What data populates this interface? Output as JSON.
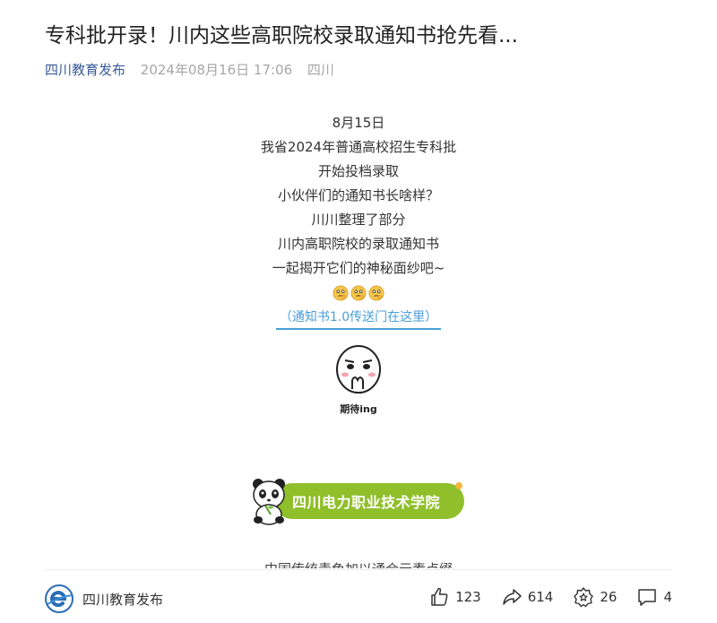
{
  "article": {
    "title": "专科批开录！川内这些高职院校录取通知书抢先看...",
    "source": "四川教育发布",
    "date": "2024年08月16日 17:06",
    "region": "四川"
  },
  "content": {
    "lines": [
      "8月15日",
      "我省2024年普通高校招生专科批",
      "开始投档录取",
      "小伙伴们的通知书长啥样？",
      "川川整理了部分",
      "川内高职院校的录取通知书",
      "一起揭开它们的神秘面纱吧~"
    ],
    "link_text": "（通知书1.0传送门在这里）",
    "sticker_caption": "期待ing",
    "banner_text": "四川电力职业技术学院",
    "cut_off_line": "中国传统青色加以通合元素点缀"
  },
  "footer": {
    "author": "四川教育发布",
    "likes": "123",
    "shares": "614",
    "favorites": "26",
    "comments": "4"
  },
  "colors": {
    "source_link": "#3b5b9a",
    "meta_gray": "#a7a7a7",
    "link_blue": "#4a9ed8",
    "banner_green": "#8fbf2a"
  }
}
